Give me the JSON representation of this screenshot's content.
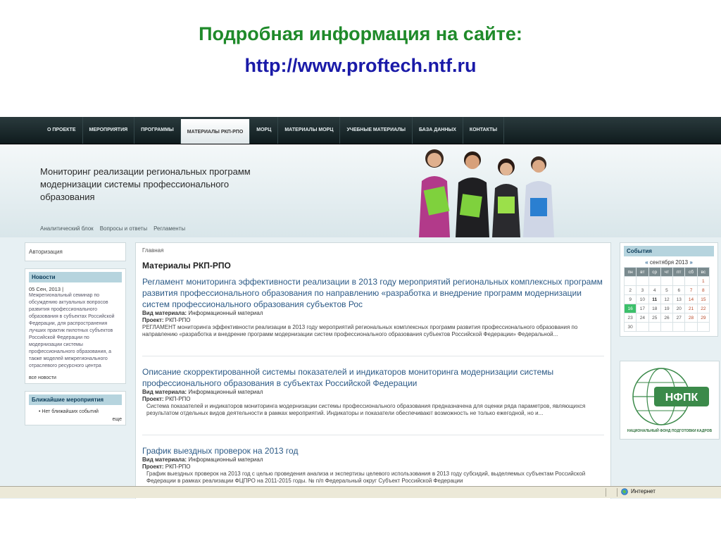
{
  "slide": {
    "title": "Подробная информация на сайте:",
    "url": "http://www.proftech.ntf.ru"
  },
  "nav": {
    "items": [
      "О ПРОЕКТЕ",
      "МЕРОПРИЯТИЯ",
      "ПРОГРАММЫ",
      "МАТЕРИАЛЫ РКП-РПО",
      "МОРЦ",
      "МАТЕРИАЛЫ МОРЦ",
      "УЧЕБНЫЕ МАТЕРИАЛЫ",
      "БАЗА ДАННЫХ",
      "КОНТАКТЫ"
    ],
    "active_index": 3
  },
  "banner": {
    "title": "Мониторинг реализации региональных программ модернизации системы профессионального образования",
    "links": [
      "Аналитический блок",
      "Вопросы и ответы",
      "Регламенты"
    ]
  },
  "left": {
    "auth": "Авторизация",
    "news": {
      "heading": "Новости",
      "date": "05 Сен, 2013 |",
      "text": "Межрегиональный семинар по обсуждению актуальных вопросов развития профессионального образования в субъектах Российской Федерации, для распространения лучших практик пилотных субъектов Российской Федерации по модернизации системы профессионального образования, а также моделей межрегионального отраслевого ресурсного центра",
      "all": "все новости"
    },
    "events": {
      "heading": "Ближайшие мероприятия",
      "item": "Нет ближайших событий",
      "more": "еще"
    }
  },
  "main": {
    "breadcrumb": "Главная",
    "heading": "Материалы РКП-РПО",
    "meta_type_label": "Вид материала:",
    "meta_project_label": "Проект:",
    "articles": [
      {
        "title": "Регламент мониторинга эффективности реализации в 2013 году мероприятий региональных комплексных программ развития профессионального образования по направлению «разработка и внедрение программ модернизации систем профессионального образования субъектов Рос",
        "type": "Информационный материал",
        "project": "РКП-РПО",
        "desc": "РЕГЛАМЕНТ мониторинга эффективности реализации в 2013 году мероприятий региональных комплексных программ развития профессионального образования по направлению «разработка и внедрение программ модернизации систем профессионального образования субъектов Российской Федерации» Федеральной..."
      },
      {
        "title": "Описание скорректированной системы показателей и индикаторов мониторинга модернизации системы профессионального образования в субъектах Российской Федерации",
        "type": "Информационный материал",
        "project": "РКП-РПО",
        "desc": "Система показателей и индикаторов мониторинга модернизации системы профессионального образования предназначена для оценки ряда параметров, являющихся результатом отдельных видов деятельности в рамках мероприятий. Индикаторы и показатели обеспечивают возможность не только ежегодной, но и..."
      },
      {
        "title": "График выездных проверок на 2013 год",
        "type": "Информационный материал",
        "project": "РКП-РПО",
        "desc": "График выездных проверок на 2013 год с целью проведения анализа и экспертизы целевого использования в 2013 году субсидий, выделяемых субъектам Российской Федерации в рамках реализации ФЦПРО на 2011-2015 годы.     № п/п Федеральный округ Субъект Российской Федерации"
      }
    ]
  },
  "right": {
    "heading": "События",
    "month": "сентября 2013",
    "prev": "«",
    "next": "»",
    "dow": [
      "пн",
      "вт",
      "ср",
      "чт",
      "пт",
      "сб",
      "вс"
    ],
    "weeks": [
      [
        "",
        "",
        "",
        "",
        "",
        "",
        "1"
      ],
      [
        "2",
        "3",
        "4",
        "5",
        "6",
        "7",
        "8"
      ],
      [
        "9",
        "10",
        "11",
        "12",
        "13",
        "14",
        "15"
      ],
      [
        "16",
        "17",
        "18",
        "19",
        "20",
        "21",
        "22"
      ],
      [
        "23",
        "24",
        "25",
        "26",
        "27",
        "28",
        "29"
      ],
      [
        "30",
        "",
        "",
        "",
        "",
        "",
        ""
      ]
    ],
    "today": "16",
    "highlight": "11",
    "logo_text": "НФПК",
    "logo_caption": "НАЦИОНАЛЬНЫЙ ФОНД ПОДГОТОВКИ КАДРОВ"
  },
  "status": {
    "zone": "Интернет"
  }
}
